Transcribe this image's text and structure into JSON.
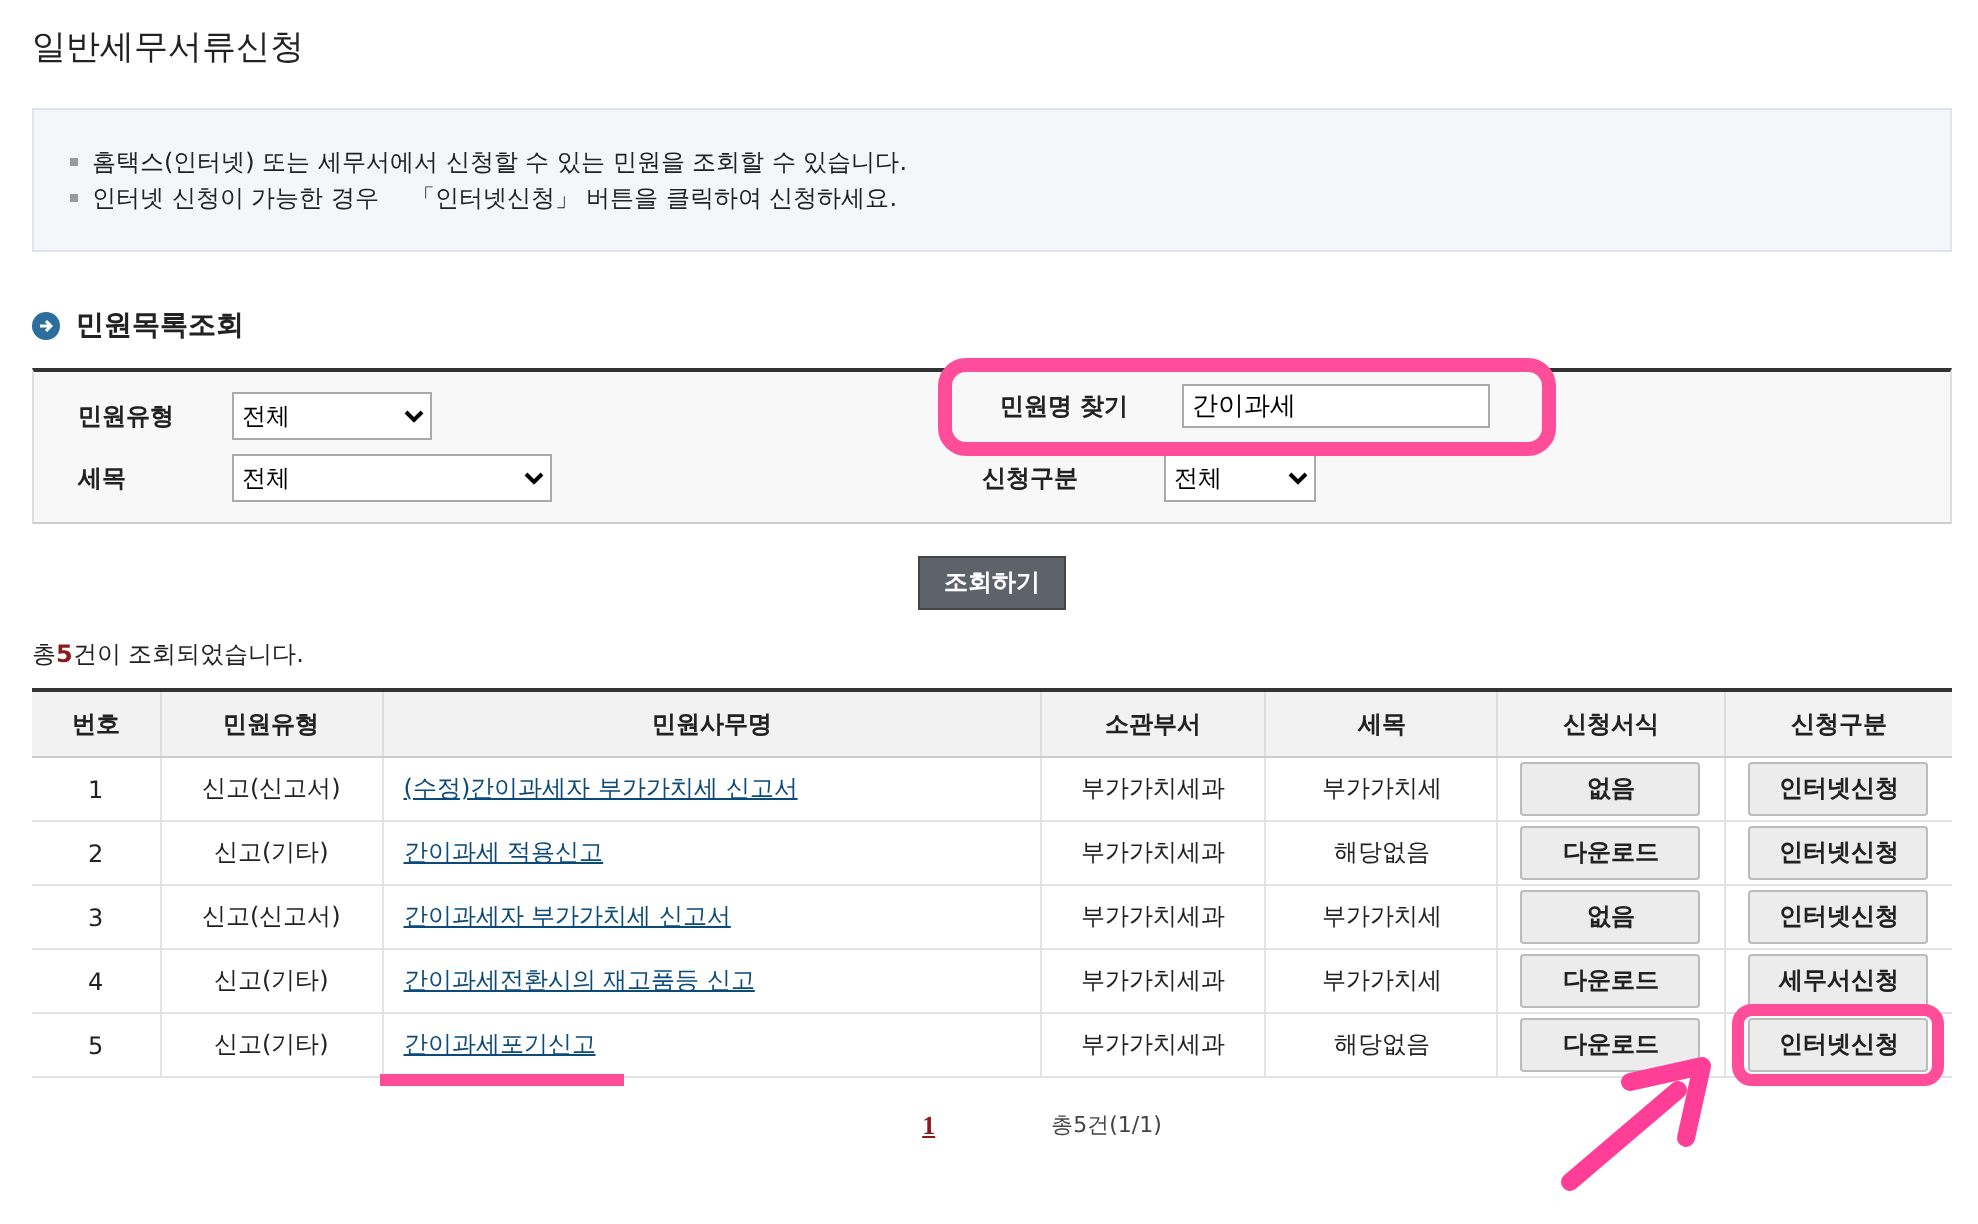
{
  "page_title": "일반세무서류신청",
  "notices": [
    "홈택스(인터넷) 또는 세무서에서 신청할 수 있는 민원을 조회할 수 있습니다.",
    "인터넷 신청이 가능한 경우 　「인터넷신청」 버튼을 클릭하여 신청하세요."
  ],
  "section_title": "민원목록조회",
  "filters": [
    {
      "kind": "select",
      "label": "민원유형",
      "value": "전체",
      "highlighted": false
    },
    {
      "kind": "input",
      "label": "민원명 찾기",
      "value": "간이과세",
      "highlighted": true
    },
    {
      "kind": "select",
      "label": "세목",
      "value": "전체",
      "highlighted": false
    },
    {
      "kind": "select",
      "label": "신청구분",
      "value": "전체",
      "highlighted": false
    }
  ],
  "search_button": "조회하기",
  "result_count": "총**5**건이 조회되었습니다.",
  "table": {
    "columns": [
      "번호",
      "민원유형",
      "민원사무명",
      "소관부서",
      "세목",
      "신청서식",
      "신청구분"
    ],
    "rows": [
      {
        "no": "1",
        "type": "신고(신고서)",
        "name": "(수정)간이과세자 부가가치세 신고서",
        "dept": "부가가치세과",
        "tax": "부가가치세",
        "form": "없음",
        "apply": "인터넷신청",
        "name_underlined": false,
        "apply_highlighted": false
      },
      {
        "no": "2",
        "type": "신고(기타)",
        "name": "간이과세 적용신고",
        "dept": "부가가치세과",
        "tax": "해당없음",
        "form": "다운로드",
        "apply": "인터넷신청",
        "name_underlined": false,
        "apply_highlighted": false
      },
      {
        "no": "3",
        "type": "신고(신고서)",
        "name": "간이과세자 부가가치세 신고서",
        "dept": "부가가치세과",
        "tax": "부가가치세",
        "form": "없음",
        "apply": "인터넷신청",
        "name_underlined": false,
        "apply_highlighted": false
      },
      {
        "no": "4",
        "type": "신고(기타)",
        "name": "간이과세전환시의 재고품등 신고",
        "dept": "부가가치세과",
        "tax": "부가가치세",
        "form": "다운로드",
        "apply": "세무서신청",
        "name_underlined": false,
        "apply_highlighted": false
      },
      {
        "no": "5",
        "type": "신고(기타)",
        "name": "간이과세포기신고",
        "dept": "부가가치세과",
        "tax": "해당없음",
        "form": "다운로드",
        "apply": "인터넷신청",
        "name_underlined": true,
        "apply_highlighted": true
      }
    ]
  },
  "pagination": {
    "pages": [
      {
        "label": "1",
        "selected": true
      }
    ],
    "summary": "총5건(1/1)"
  }
}
